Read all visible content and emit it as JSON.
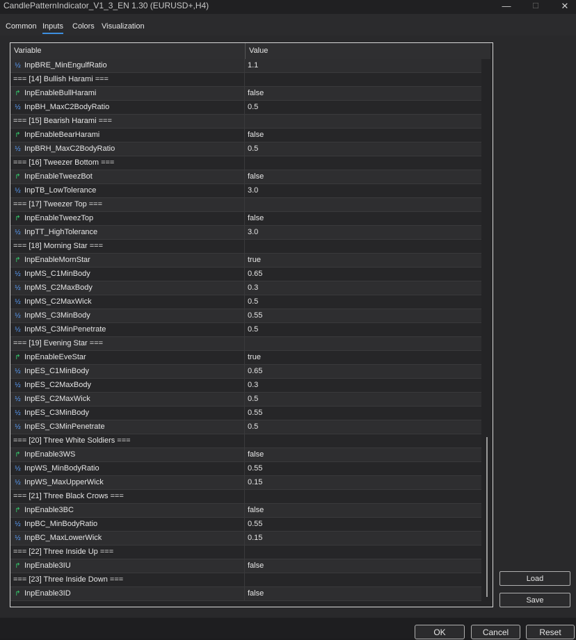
{
  "window": {
    "title": "CandlePatternIndicator_V1_3_EN 1.30 (EURUSD+,H4)",
    "minimize_glyph": "—",
    "maximize_glyph": "☐",
    "close_glyph": "✕"
  },
  "tabs": [
    {
      "label": "Common"
    },
    {
      "label": "Inputs",
      "active": true
    },
    {
      "label": "Colors"
    },
    {
      "label": "Visualization"
    }
  ],
  "grid": {
    "columns": [
      "Variable",
      "Value"
    ],
    "rows": [
      {
        "type": "num",
        "name": "InpBRE_MinEngulfRatio",
        "value": "1.1"
      },
      {
        "type": "section",
        "name": "=== [14] Bullish Harami ===",
        "value": ""
      },
      {
        "type": "bool",
        "name": "InpEnableBullHarami",
        "value": "false"
      },
      {
        "type": "num",
        "name": "InpBH_MaxC2BodyRatio",
        "value": "0.5"
      },
      {
        "type": "section",
        "name": "=== [15] Bearish Harami ===",
        "value": ""
      },
      {
        "type": "bool",
        "name": "InpEnableBearHarami",
        "value": "false"
      },
      {
        "type": "num",
        "name": "InpBRH_MaxC2BodyRatio",
        "value": "0.5"
      },
      {
        "type": "section",
        "name": "=== [16] Tweezer Bottom ===",
        "value": ""
      },
      {
        "type": "bool",
        "name": "InpEnableTweezBot",
        "value": "false"
      },
      {
        "type": "num",
        "name": "InpTB_LowTolerance",
        "value": "3.0"
      },
      {
        "type": "section",
        "name": "=== [17] Tweezer Top ===",
        "value": ""
      },
      {
        "type": "bool",
        "name": "InpEnableTweezTop",
        "value": "false"
      },
      {
        "type": "num",
        "name": "InpTT_HighTolerance",
        "value": "3.0"
      },
      {
        "type": "section",
        "name": "=== [18] Morning Star ===",
        "value": ""
      },
      {
        "type": "bool",
        "name": "InpEnableMornStar",
        "value": "true"
      },
      {
        "type": "num",
        "name": "InpMS_C1MinBody",
        "value": "0.65"
      },
      {
        "type": "num",
        "name": "InpMS_C2MaxBody",
        "value": "0.3"
      },
      {
        "type": "num",
        "name": "InpMS_C2MaxWick",
        "value": "0.5"
      },
      {
        "type": "num",
        "name": "InpMS_C3MinBody",
        "value": "0.55"
      },
      {
        "type": "num",
        "name": "InpMS_C3MinPenetrate",
        "value": "0.5"
      },
      {
        "type": "section",
        "name": "=== [19] Evening Star ===",
        "value": ""
      },
      {
        "type": "bool",
        "name": "InpEnableEveStar",
        "value": "true"
      },
      {
        "type": "num",
        "name": "InpES_C1MinBody",
        "value": "0.65"
      },
      {
        "type": "num",
        "name": "InpES_C2MaxBody",
        "value": "0.3"
      },
      {
        "type": "num",
        "name": "InpES_C2MaxWick",
        "value": "0.5"
      },
      {
        "type": "num",
        "name": "InpES_C3MinBody",
        "value": "0.55"
      },
      {
        "type": "num",
        "name": "InpES_C3MinPenetrate",
        "value": "0.5"
      },
      {
        "type": "section",
        "name": "=== [20] Three White Soldiers ===",
        "value": ""
      },
      {
        "type": "bool",
        "name": "InpEnable3WS",
        "value": "false"
      },
      {
        "type": "num",
        "name": "InpWS_MinBodyRatio",
        "value": "0.55"
      },
      {
        "type": "num",
        "name": "InpWS_MaxUpperWick",
        "value": "0.15"
      },
      {
        "type": "section",
        "name": "=== [21] Three Black Crows ===",
        "value": ""
      },
      {
        "type": "bool",
        "name": "InpEnable3BC",
        "value": "false"
      },
      {
        "type": "num",
        "name": "InpBC_MinBodyRatio",
        "value": "0.55"
      },
      {
        "type": "num",
        "name": "InpBC_MaxLowerWick",
        "value": "0.15"
      },
      {
        "type": "section",
        "name": "=== [22] Three Inside Up ===",
        "value": ""
      },
      {
        "type": "bool",
        "name": "InpEnable3IU",
        "value": "false"
      },
      {
        "type": "section",
        "name": "=== [23] Three Inside Down ===",
        "value": ""
      },
      {
        "type": "bool",
        "name": "InpEnable3ID",
        "value": "false"
      }
    ]
  },
  "side_buttons": {
    "load": "Load",
    "save": "Save"
  },
  "footer_buttons": {
    "ok": "OK",
    "cancel": "Cancel",
    "reset": "Reset"
  },
  "icons": {
    "num": "half-fraction-icon",
    "bool": "boolean-arrow-icon"
  },
  "colors": {
    "accent": "#3d8fe0",
    "num_icon": "#5aa0ff",
    "bool_icon": "#34c76a"
  }
}
